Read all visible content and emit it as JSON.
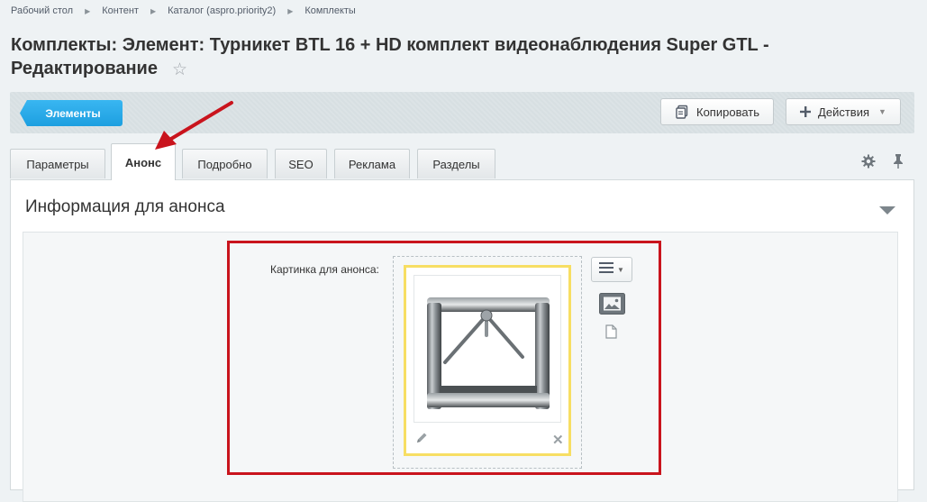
{
  "breadcrumb": {
    "items": [
      "Рабочий стол",
      "Контент",
      "Каталог (aspro.priority2)",
      "Комплекты"
    ]
  },
  "page": {
    "title": "Комплекты: Элемент: Турникет BTL 16 + HD комплект видеонаблюдения Super GTL - Редактирование",
    "star_icon": "star-icon"
  },
  "toolbar": {
    "elements_label": "Элементы",
    "copy_label": "Копировать",
    "actions_label": "Действия"
  },
  "tabs": [
    {
      "label": "Параметры"
    },
    {
      "label": "Анонс",
      "active": true
    },
    {
      "label": "Подробно"
    },
    {
      "label": "SEO"
    },
    {
      "label": "Реклама"
    },
    {
      "label": "Разделы"
    }
  ],
  "section": {
    "title": "Информация для анонса",
    "field_label": "Картинка для анонса:"
  },
  "colors": {
    "accent": "#1d9fe0",
    "highlight_border": "#c9141d",
    "image_border": "#f7de63",
    "annotation_arrow": "#c9141d"
  }
}
